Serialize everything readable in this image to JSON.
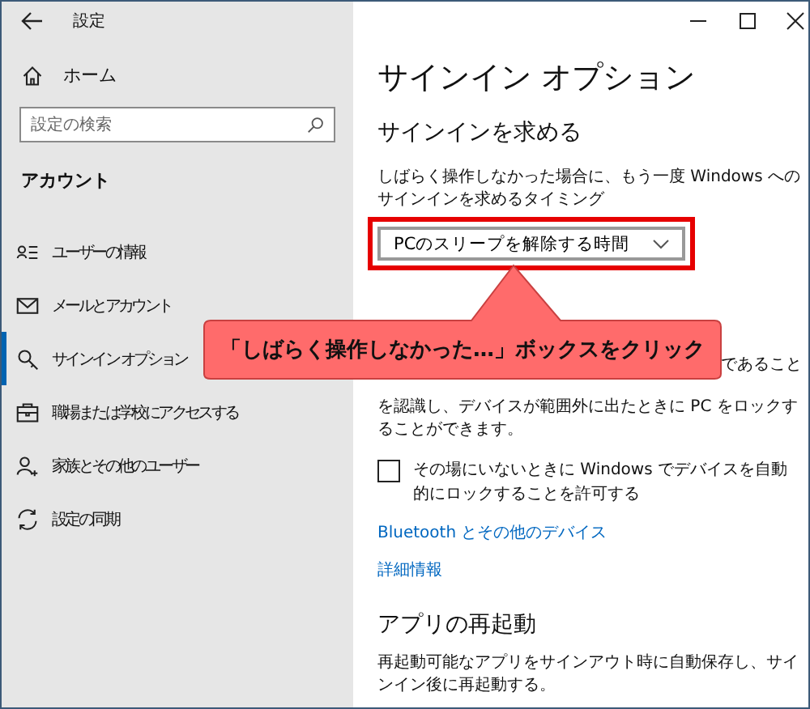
{
  "window": {
    "title": "設定"
  },
  "sidebar": {
    "home": "ホーム",
    "search": {
      "placeholder": "設定の検索"
    },
    "section": "アカウント",
    "items": [
      {
        "label": "ユーザーの情報",
        "kind": "person-list",
        "selected": false
      },
      {
        "label": "メールとアカウント",
        "kind": "mail",
        "selected": false
      },
      {
        "label": "サインイン オプション",
        "kind": "key",
        "selected": true
      },
      {
        "label": "職場または学校にアクセスする",
        "kind": "briefcase",
        "selected": false
      },
      {
        "label": "家族とその他のユーザー",
        "kind": "person-add",
        "selected": false
      },
      {
        "label": "設定の同期",
        "kind": "sync",
        "selected": false
      }
    ]
  },
  "content": {
    "title": "サインイン オプション",
    "heading": "サインインを求める",
    "description": "しばらく操作しなかった場合に、もう一度 Windows へのサインインを求めるタイミング",
    "dropdown": {
      "value": "PCのスリープを解除する時間"
    },
    "dynamic_lock_visible_start": "であること",
    "dynamic_lock_rest": "を認識し、デバイスが範囲外に出たときに PC をロックすることができます。",
    "checkbox": {
      "label": "その場にいないときに Windows でデバイスを自動的にロックすることを許可する",
      "checked": false
    },
    "links": [
      "Bluetooth とその他のデバイス",
      "詳細情報"
    ],
    "restart_heading": "アプリの再起動",
    "restart_text": "再起動可能なアプリをサインアウト時に自動保存し、サインイン後に再起動する。"
  },
  "callout": {
    "text": "「しばらく操作しなかった…」ボックスをクリック"
  }
}
